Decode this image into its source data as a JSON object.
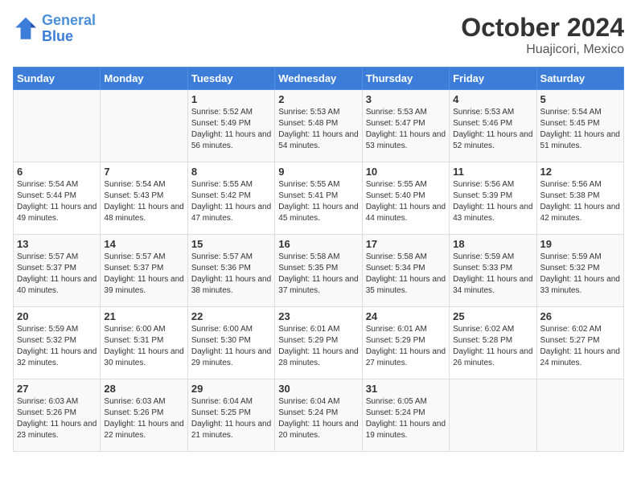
{
  "header": {
    "logo_line1": "General",
    "logo_line2": "Blue",
    "month": "October 2024",
    "location": "Huajicori, Mexico"
  },
  "days_of_week": [
    "Sunday",
    "Monday",
    "Tuesday",
    "Wednesday",
    "Thursday",
    "Friday",
    "Saturday"
  ],
  "weeks": [
    [
      {
        "day": "",
        "info": ""
      },
      {
        "day": "",
        "info": ""
      },
      {
        "day": "1",
        "info": "Sunrise: 5:52 AM\nSunset: 5:49 PM\nDaylight: 11 hours and 56 minutes."
      },
      {
        "day": "2",
        "info": "Sunrise: 5:53 AM\nSunset: 5:48 PM\nDaylight: 11 hours and 54 minutes."
      },
      {
        "day": "3",
        "info": "Sunrise: 5:53 AM\nSunset: 5:47 PM\nDaylight: 11 hours and 53 minutes."
      },
      {
        "day": "4",
        "info": "Sunrise: 5:53 AM\nSunset: 5:46 PM\nDaylight: 11 hours and 52 minutes."
      },
      {
        "day": "5",
        "info": "Sunrise: 5:54 AM\nSunset: 5:45 PM\nDaylight: 11 hours and 51 minutes."
      }
    ],
    [
      {
        "day": "6",
        "info": "Sunrise: 5:54 AM\nSunset: 5:44 PM\nDaylight: 11 hours and 49 minutes."
      },
      {
        "day": "7",
        "info": "Sunrise: 5:54 AM\nSunset: 5:43 PM\nDaylight: 11 hours and 48 minutes."
      },
      {
        "day": "8",
        "info": "Sunrise: 5:55 AM\nSunset: 5:42 PM\nDaylight: 11 hours and 47 minutes."
      },
      {
        "day": "9",
        "info": "Sunrise: 5:55 AM\nSunset: 5:41 PM\nDaylight: 11 hours and 45 minutes."
      },
      {
        "day": "10",
        "info": "Sunrise: 5:55 AM\nSunset: 5:40 PM\nDaylight: 11 hours and 44 minutes."
      },
      {
        "day": "11",
        "info": "Sunrise: 5:56 AM\nSunset: 5:39 PM\nDaylight: 11 hours and 43 minutes."
      },
      {
        "day": "12",
        "info": "Sunrise: 5:56 AM\nSunset: 5:38 PM\nDaylight: 11 hours and 42 minutes."
      }
    ],
    [
      {
        "day": "13",
        "info": "Sunrise: 5:57 AM\nSunset: 5:37 PM\nDaylight: 11 hours and 40 minutes."
      },
      {
        "day": "14",
        "info": "Sunrise: 5:57 AM\nSunset: 5:37 PM\nDaylight: 11 hours and 39 minutes."
      },
      {
        "day": "15",
        "info": "Sunrise: 5:57 AM\nSunset: 5:36 PM\nDaylight: 11 hours and 38 minutes."
      },
      {
        "day": "16",
        "info": "Sunrise: 5:58 AM\nSunset: 5:35 PM\nDaylight: 11 hours and 37 minutes."
      },
      {
        "day": "17",
        "info": "Sunrise: 5:58 AM\nSunset: 5:34 PM\nDaylight: 11 hours and 35 minutes."
      },
      {
        "day": "18",
        "info": "Sunrise: 5:59 AM\nSunset: 5:33 PM\nDaylight: 11 hours and 34 minutes."
      },
      {
        "day": "19",
        "info": "Sunrise: 5:59 AM\nSunset: 5:32 PM\nDaylight: 11 hours and 33 minutes."
      }
    ],
    [
      {
        "day": "20",
        "info": "Sunrise: 5:59 AM\nSunset: 5:32 PM\nDaylight: 11 hours and 32 minutes."
      },
      {
        "day": "21",
        "info": "Sunrise: 6:00 AM\nSunset: 5:31 PM\nDaylight: 11 hours and 30 minutes."
      },
      {
        "day": "22",
        "info": "Sunrise: 6:00 AM\nSunset: 5:30 PM\nDaylight: 11 hours and 29 minutes."
      },
      {
        "day": "23",
        "info": "Sunrise: 6:01 AM\nSunset: 5:29 PM\nDaylight: 11 hours and 28 minutes."
      },
      {
        "day": "24",
        "info": "Sunrise: 6:01 AM\nSunset: 5:29 PM\nDaylight: 11 hours and 27 minutes."
      },
      {
        "day": "25",
        "info": "Sunrise: 6:02 AM\nSunset: 5:28 PM\nDaylight: 11 hours and 26 minutes."
      },
      {
        "day": "26",
        "info": "Sunrise: 6:02 AM\nSunset: 5:27 PM\nDaylight: 11 hours and 24 minutes."
      }
    ],
    [
      {
        "day": "27",
        "info": "Sunrise: 6:03 AM\nSunset: 5:26 PM\nDaylight: 11 hours and 23 minutes."
      },
      {
        "day": "28",
        "info": "Sunrise: 6:03 AM\nSunset: 5:26 PM\nDaylight: 11 hours and 22 minutes."
      },
      {
        "day": "29",
        "info": "Sunrise: 6:04 AM\nSunset: 5:25 PM\nDaylight: 11 hours and 21 minutes."
      },
      {
        "day": "30",
        "info": "Sunrise: 6:04 AM\nSunset: 5:24 PM\nDaylight: 11 hours and 20 minutes."
      },
      {
        "day": "31",
        "info": "Sunrise: 6:05 AM\nSunset: 5:24 PM\nDaylight: 11 hours and 19 minutes."
      },
      {
        "day": "",
        "info": ""
      },
      {
        "day": "",
        "info": ""
      }
    ]
  ]
}
